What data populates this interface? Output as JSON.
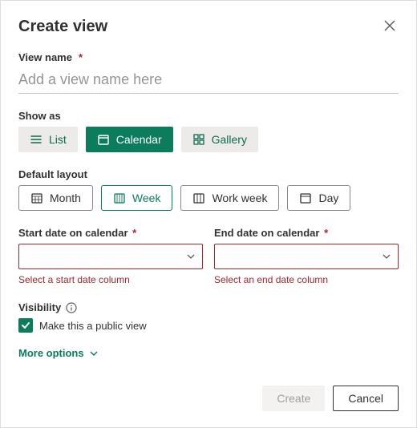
{
  "dialog": {
    "title": "Create view",
    "viewName": {
      "label": "View name",
      "placeholder": "Add a view name here"
    },
    "showAs": {
      "label": "Show as",
      "options": {
        "list": "List",
        "calendar": "Calendar",
        "gallery": "Gallery"
      },
      "selected": "calendar"
    },
    "defaultLayout": {
      "label": "Default layout",
      "options": {
        "month": "Month",
        "week": "Week",
        "workweek": "Work week",
        "day": "Day"
      },
      "selected": "week"
    },
    "startDate": {
      "label": "Start date on calendar",
      "error": "Select a start date column"
    },
    "endDate": {
      "label": "End date on calendar",
      "error": "Select an end date column"
    },
    "visibility": {
      "label": "Visibility",
      "checkboxLabel": "Make this a public view",
      "checked": true
    },
    "moreOptions": "More options",
    "buttons": {
      "create": "Create",
      "cancel": "Cancel"
    },
    "colors": {
      "accent": "#0b7c5c",
      "error": "#a4262c"
    }
  }
}
